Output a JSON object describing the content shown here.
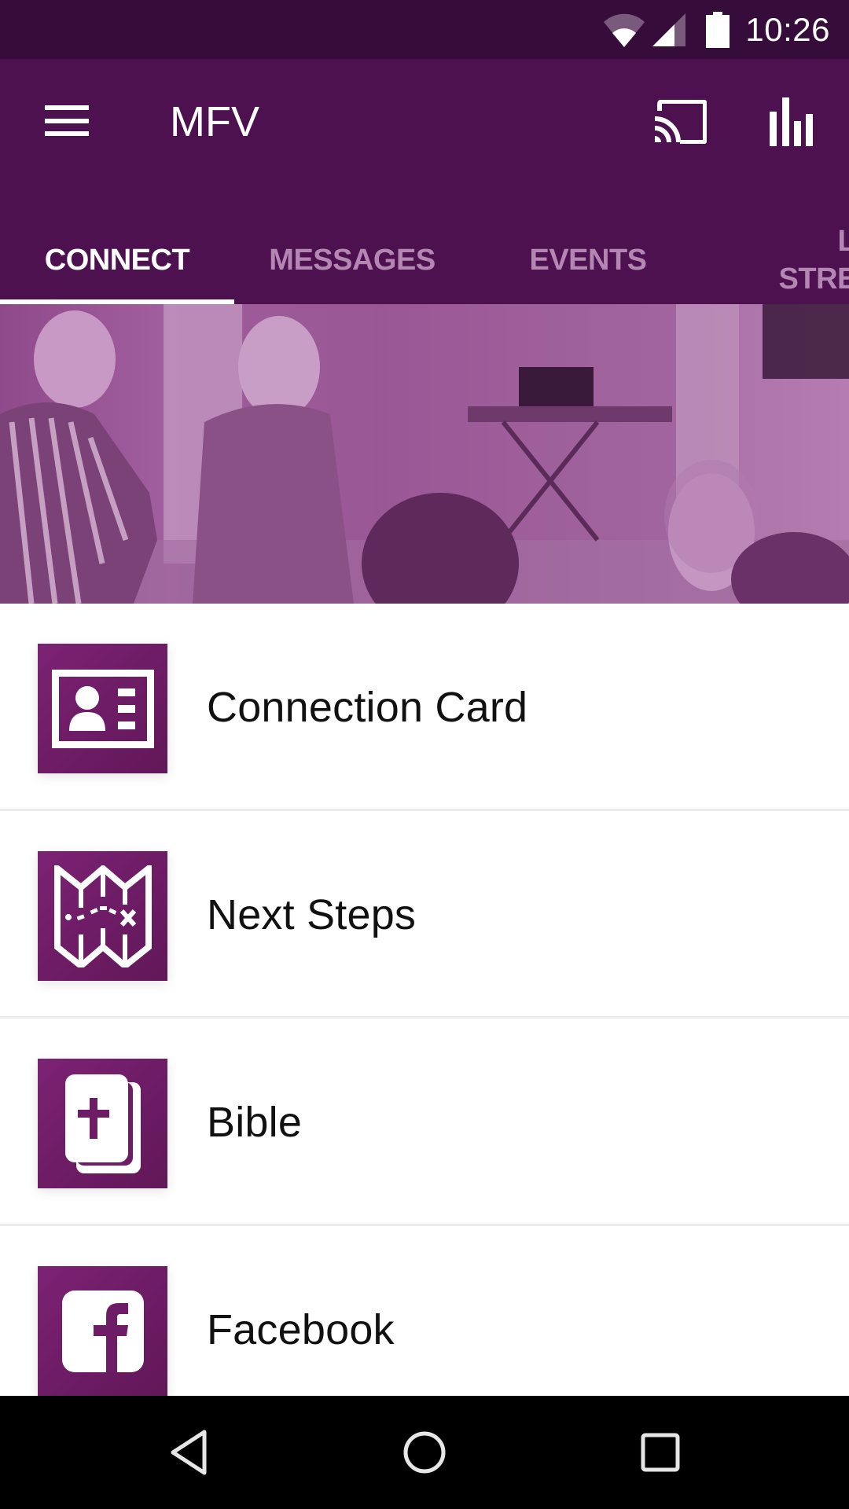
{
  "status_bar": {
    "time": "10:26",
    "icons": [
      "wifi-icon",
      "cell-signal-icon",
      "battery-icon"
    ]
  },
  "app_bar": {
    "title": "MFV",
    "menu_icon": "hamburger-menu-icon",
    "actions": [
      {
        "name": "cast",
        "icon": "cast-icon"
      },
      {
        "name": "stats",
        "icon": "bar-chart-icon"
      }
    ]
  },
  "tabs": [
    {
      "label": "CONNECT",
      "active": true
    },
    {
      "label": "MESSAGES",
      "active": false
    },
    {
      "label": "EVENTS",
      "active": false
    },
    {
      "label": "LIVE STREAM",
      "active": false
    }
  ],
  "banner": {
    "description": "Purple-tinted photo of people greeting each other in a church venue"
  },
  "list": [
    {
      "label": "Connection Card",
      "icon": "contact-card-icon"
    },
    {
      "label": "Next Steps",
      "icon": "treasure-map-icon"
    },
    {
      "label": "Bible",
      "icon": "bible-icon"
    },
    {
      "label": "Facebook",
      "icon": "facebook-icon"
    }
  ],
  "nav_bar": {
    "buttons": [
      "back-icon",
      "home-icon",
      "recents-icon"
    ]
  },
  "colors": {
    "status_bar": "#360c3a",
    "app_bar": "#4d1150",
    "tab_active": "#ffffff",
    "tab_inactive": "#b487b3",
    "tile": "#6e1c66"
  }
}
